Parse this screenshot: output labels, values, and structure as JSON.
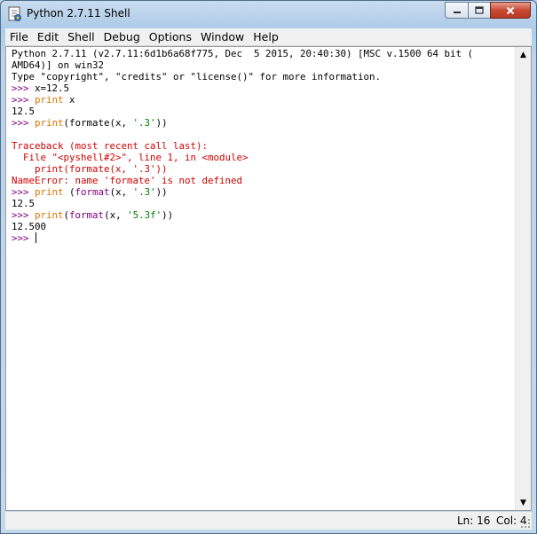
{
  "window": {
    "title": "Python 2.7.11 Shell"
  },
  "menu": [
    "File",
    "Edit",
    "Shell",
    "Debug",
    "Options",
    "Window",
    "Help"
  ],
  "shell_lines": [
    [
      {
        "t": "Python 2.7.11 (v2.7.11:6d1b6a68f775, Dec  5 2015, 20:40:30) [MSC v.1500 64 bit (",
        "c": "blk"
      }
    ],
    [
      {
        "t": "AMD64)] on win32",
        "c": "blk"
      }
    ],
    [
      {
        "t": "Type \"copyright\", \"credits\" or \"license()\" for more information.",
        "c": "blk"
      }
    ],
    [
      {
        "t": ">>> ",
        "c": "pur"
      },
      {
        "t": "x=12.5",
        "c": "blk"
      }
    ],
    [
      {
        "t": ">>> ",
        "c": "pur"
      },
      {
        "t": "print",
        "c": "org"
      },
      {
        "t": " x",
        "c": "blk"
      }
    ],
    [
      {
        "t": "12.5",
        "c": "blk"
      }
    ],
    [
      {
        "t": ">>> ",
        "c": "pur"
      },
      {
        "t": "print",
        "c": "org"
      },
      {
        "t": "(formate(x, ",
        "c": "blk"
      },
      {
        "t": "'.3'",
        "c": "grn"
      },
      {
        "t": "))",
        "c": "blk"
      }
    ],
    [],
    [
      {
        "t": "Traceback (most recent call last):",
        "c": "red"
      }
    ],
    [
      {
        "t": "  File \"<pyshell#2>\", line 1, in <module>",
        "c": "red"
      }
    ],
    [
      {
        "t": "    print(formate(x, '.3'))",
        "c": "red"
      }
    ],
    [
      {
        "t": "NameError: name 'formate' is not defined",
        "c": "red"
      }
    ],
    [
      {
        "t": ">>> ",
        "c": "pur"
      },
      {
        "t": "print",
        "c": "org"
      },
      {
        "t": " (",
        "c": "blk"
      },
      {
        "t": "format",
        "c": "pur"
      },
      {
        "t": "(x, ",
        "c": "blk"
      },
      {
        "t": "'.3'",
        "c": "grn"
      },
      {
        "t": "))",
        "c": "blk"
      }
    ],
    [
      {
        "t": "12.5",
        "c": "blk"
      }
    ],
    [
      {
        "t": ">>> ",
        "c": "pur"
      },
      {
        "t": "print",
        "c": "org"
      },
      {
        "t": "(",
        "c": "blk"
      },
      {
        "t": "format",
        "c": "pur"
      },
      {
        "t": "(x, ",
        "c": "blk"
      },
      {
        "t": "'5.3f'",
        "c": "grn"
      },
      {
        "t": "))",
        "c": "blk"
      }
    ],
    [
      {
        "t": "12.500",
        "c": "blk"
      }
    ],
    [
      {
        "t": ">>> ",
        "c": "pur"
      }
    ]
  ],
  "status": {
    "line": "Ln: 16",
    "col": "Col: 4"
  },
  "colors": {
    "prompt": "#800080",
    "keyword": "#e07000",
    "string": "#008000",
    "error": "#d00000"
  }
}
